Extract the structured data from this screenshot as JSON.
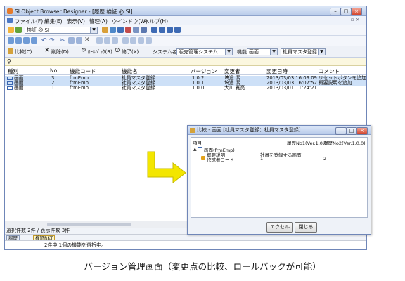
{
  "window": {
    "title": "SI Object Browser Designer - [履歴 検証 @ SI]",
    "menu": [
      "ファイル(F)",
      "編集(E)",
      "表示(V)",
      "管理(A)",
      "ウインドウ(W)",
      "ヘルプ(H)"
    ],
    "connection_combo": "検証 @ SI"
  },
  "toolbar3": {
    "compare": "比較(C)",
    "delete": "削除(D)",
    "rollback": "ﾛｰﾙﾊﾞｯｸ(R)",
    "close": "終了(X)",
    "system_label": "システム名",
    "system_value": "販売管理システム",
    "function_label": "機能",
    "function_value": "画面",
    "target_value": "社員マスタ登録"
  },
  "table": {
    "columns": [
      "種別",
      "No",
      "機能コード",
      "機能名",
      "バージョン",
      "変更者",
      "変更日時",
      "コメント"
    ],
    "rows": [
      {
        "type": "画面",
        "no": "3",
        "code": "frmEmp",
        "name": "社員マスタ登録",
        "version": "1.0.2",
        "user": "塙途 潔",
        "datetime": "2013/03/03 16:09:09",
        "comment": "リセットボタンを追加"
      },
      {
        "type": "画面",
        "no": "2",
        "code": "frmEmp",
        "name": "社員マスタ登録",
        "version": "1.0.1",
        "user": "塙途 潔",
        "datetime": "2013/03/03 16:07:52",
        "comment": "概要説明を追加"
      },
      {
        "type": "画面",
        "no": "1",
        "code": "frmEmp",
        "name": "社員マスタ登録",
        "version": "1.0.0",
        "user": "大川 寛亮",
        "datetime": "2013/03/01 11:24:21",
        "comment": ""
      }
    ]
  },
  "status": {
    "count": "選択件数 2件 / 表示件数 3件",
    "tabs": [
      "履歴",
      "検証RKT"
    ],
    "message": "2件中 1個の機能を選択中。"
  },
  "dialog": {
    "title": "比較 - 画面 [社員マスタ登録：社員マスタ登録]",
    "columns": [
      "項目",
      "履歴No1(Ver.1.0.1)",
      "履歴No2(Ver.1.0.0)"
    ],
    "tree_root": "画面(frmEmp)",
    "rows": [
      {
        "label": "概要説明",
        "v1": "社員を登録する画面",
        "v2": ""
      },
      {
        "label": "作成者コード",
        "v1": "1",
        "v2": "2"
      }
    ],
    "excel_button": "エクセル",
    "close_button": "閉じる"
  },
  "caption": "バージョン管理画面（変更点の比較、ロールバックが可能）",
  "colors": {
    "arrow": "#f3e600",
    "selection": "#cde0f7",
    "accent": "#6f86b8"
  }
}
